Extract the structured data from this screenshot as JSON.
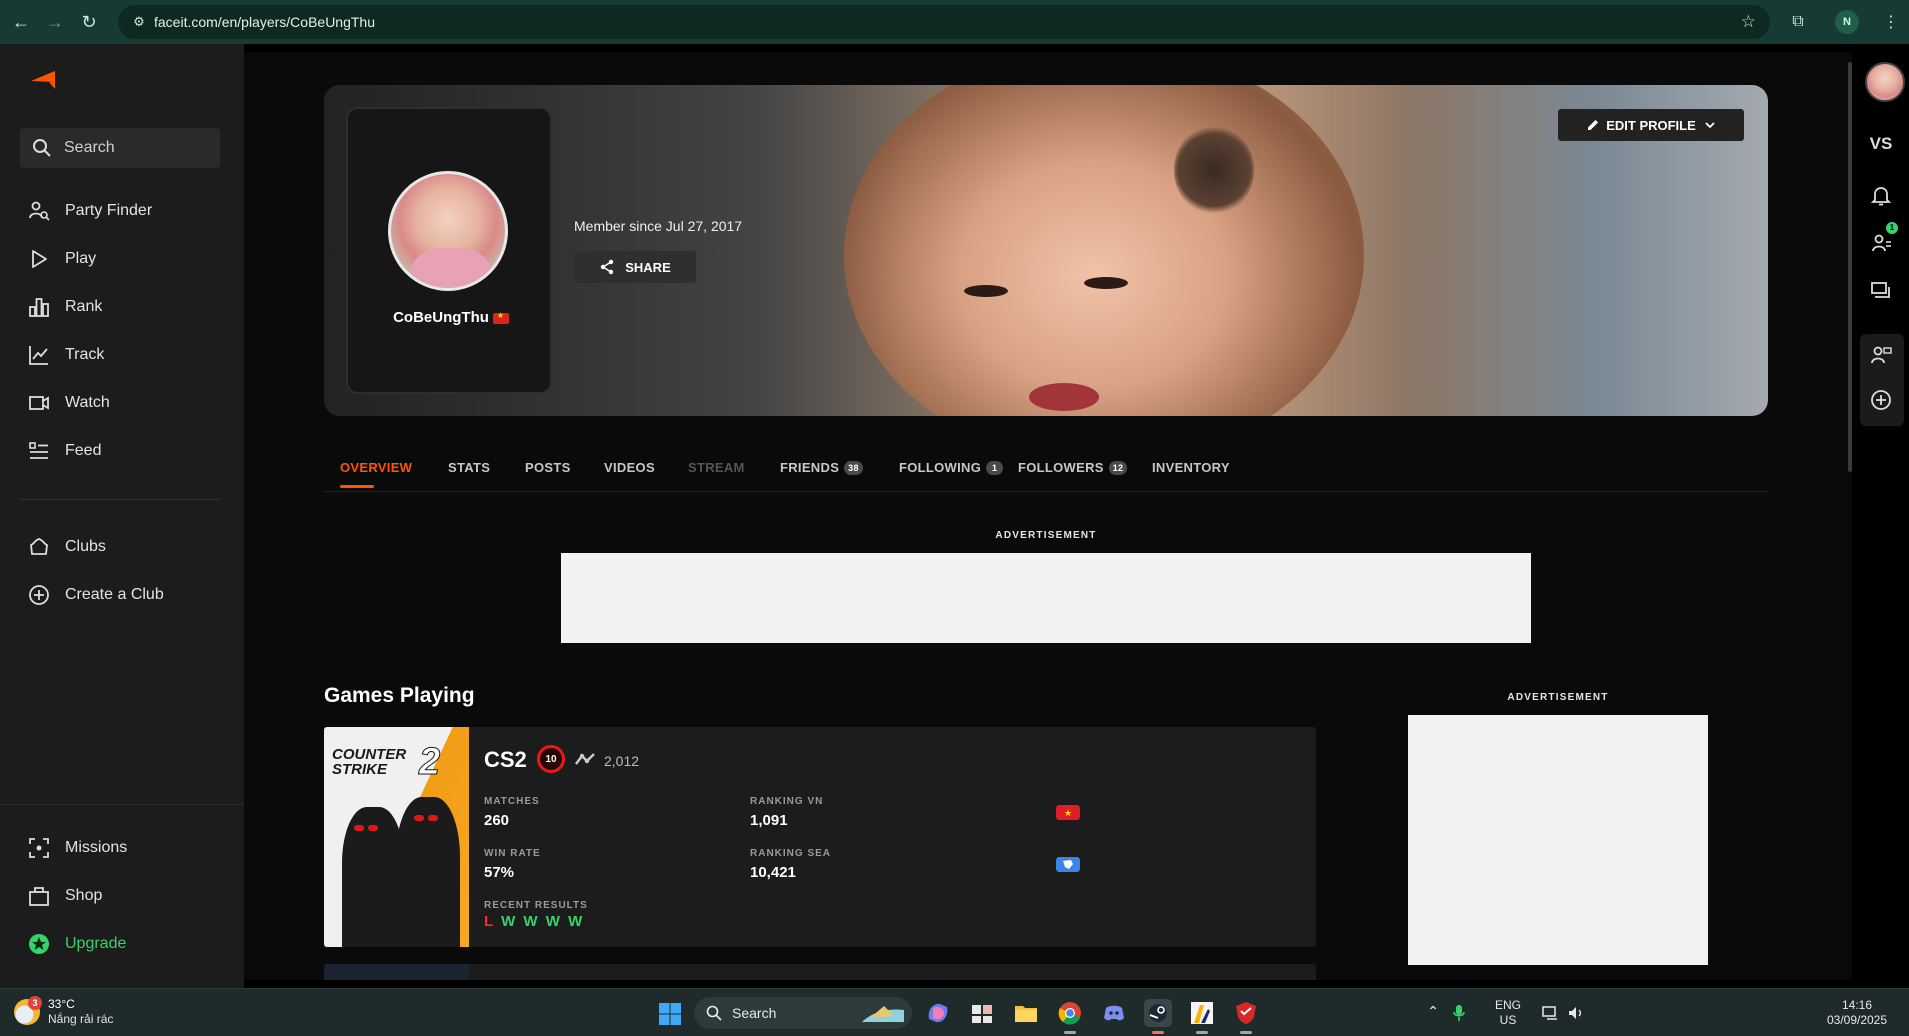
{
  "browser": {
    "url": "faceit.com/en/players/CoBeUngThu",
    "profile_initial": "N"
  },
  "sidebar": {
    "search_label": "Search",
    "items": [
      {
        "label": "Party Finder",
        "icon": "party-finder-icon"
      },
      {
        "label": "Play",
        "icon": "play-icon"
      },
      {
        "label": "Rank",
        "icon": "rank-icon"
      },
      {
        "label": "Track",
        "icon": "track-icon"
      },
      {
        "label": "Watch",
        "icon": "watch-icon"
      },
      {
        "label": "Feed",
        "icon": "feed-icon"
      }
    ],
    "club_items": [
      {
        "label": "Clubs",
        "icon": "clubs-icon"
      },
      {
        "label": "Create a Club",
        "icon": "plus-circle-icon"
      }
    ],
    "bottom_items": [
      {
        "label": "Missions",
        "icon": "missions-icon"
      },
      {
        "label": "Shop",
        "icon": "shop-icon"
      },
      {
        "label": "Upgrade",
        "icon": "upgrade-icon"
      }
    ]
  },
  "profile": {
    "username": "CoBeUngThu",
    "member_since": "Member since Jul 27, 2017",
    "share_label": "SHARE",
    "edit_label": "EDIT PROFILE"
  },
  "tabs": [
    {
      "label": "OVERVIEW",
      "active": true
    },
    {
      "label": "STATS"
    },
    {
      "label": "POSTS"
    },
    {
      "label": "VIDEOS"
    },
    {
      "label": "STREAM",
      "disabled": true
    },
    {
      "label": "FRIENDS",
      "badge": "38"
    },
    {
      "label": "FOLLOWING",
      "badge": "1"
    },
    {
      "label": "FOLLOWERS",
      "badge": "12"
    },
    {
      "label": "INVENTORY"
    }
  ],
  "ads": {
    "top_label": "ADVERTISEMENT",
    "side_label": "ADVERTISEMENT"
  },
  "games": {
    "section_title": "Games Playing",
    "cs2": {
      "cover_title_line1": "COUNTER",
      "cover_title_line2": "STRIKE",
      "cover_number": "2",
      "name": "CS2",
      "level": "10",
      "elo": "2,012",
      "matches_label": "MATCHES",
      "matches": "260",
      "win_rate_label": "WIN RATE",
      "win_rate": "57%",
      "ranking_vn_label": "RANKING VN",
      "ranking_vn": "1,091",
      "ranking_sea_label": "RANKING SEA",
      "ranking_sea": "10,421",
      "recent_label": "RECENT RESULTS",
      "recent": [
        "L",
        "W",
        "W",
        "W",
        "W"
      ]
    }
  },
  "rail": {
    "vs_label": "VS",
    "friends_badge": "1"
  },
  "taskbar": {
    "weather_badge": "3",
    "temperature": "33°C",
    "condition": "Nắng rải rác",
    "search_label": "Search",
    "lang_line1": "ENG",
    "lang_line2": "US",
    "time": "14:16",
    "date": "03/09/2025"
  },
  "colors": {
    "accent": "#ff5500",
    "win": "#36d36a",
    "loss": "#ff2b2b"
  }
}
